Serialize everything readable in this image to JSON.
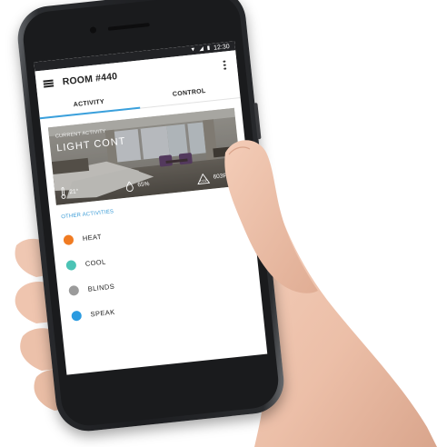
{
  "status_bar": {
    "time": "12:30"
  },
  "app_bar": {
    "title": "ROOM #440",
    "menu_icon": "hamburger-menu-icon",
    "more_icon": "more-vert-icon"
  },
  "tabs": [
    {
      "label": "ACTIVITY",
      "active": true
    },
    {
      "label": "CONTROL",
      "active": false
    }
  ],
  "current_activity": {
    "label": "CURRENT ACTIVITY",
    "value": "LIGHT CONT",
    "stats": {
      "temperature": "21°",
      "humidity": "65%",
      "co2": "603PPM"
    }
  },
  "other_activities": {
    "label": "OTHER ACTIVITIES",
    "items": [
      {
        "label": "HEAT",
        "color": "#f07b22"
      },
      {
        "label": "COOL",
        "color": "#4cc3b5"
      },
      {
        "label": "BLINDS",
        "color": "#9b9b9b"
      },
      {
        "label": "SPEAK",
        "color": "#2b9be0"
      }
    ]
  },
  "colors": {
    "accent": "#3aa0dc",
    "section_label": "#3a9bd6"
  }
}
